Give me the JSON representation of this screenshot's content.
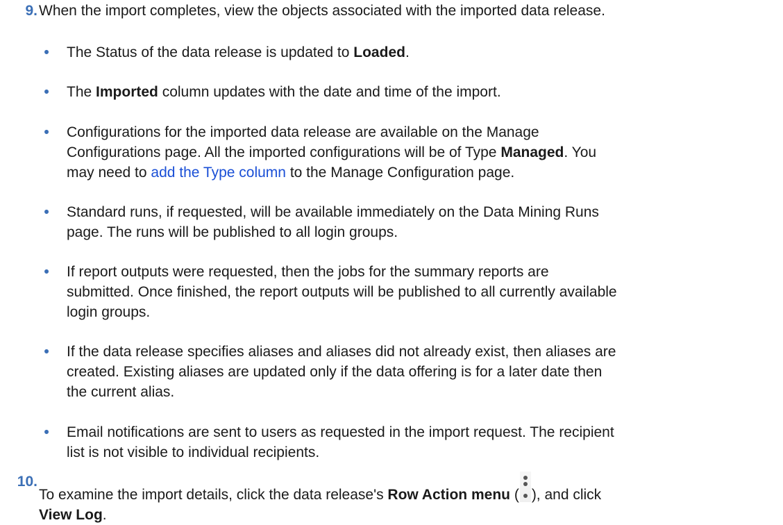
{
  "step9": {
    "number": "9.",
    "text": "When the import completes, view the objects associated with the imported data release."
  },
  "bullets": [
    {
      "parts": [
        {
          "t": "The Status of the data release is updated to "
        },
        {
          "t": "Loaded",
          "b": true
        },
        {
          "t": "."
        }
      ]
    },
    {
      "parts": [
        {
          "t": "The "
        },
        {
          "t": "Imported",
          "b": true
        },
        {
          "t": " column updates with the date and time of the import."
        }
      ]
    },
    {
      "lines": [
        [
          {
            "t": "Configurations for the imported data release are available on the Manage"
          }
        ],
        [
          {
            "t": "Configurations page. All the imported configurations will be of Type "
          },
          {
            "t": "Managed",
            "b": true
          },
          {
            "t": ". You"
          }
        ],
        [
          {
            "t": "may need to "
          },
          {
            "t": "add the Type column",
            "link": true
          },
          {
            "t": " to the Manage Configuration page."
          }
        ]
      ]
    },
    {
      "lines": [
        [
          {
            "t": "Standard runs, if requested, will be available immediately on the Data Mining Runs"
          }
        ],
        [
          {
            "t": "page. The runs will be published to all login groups."
          }
        ]
      ]
    },
    {
      "lines": [
        [
          {
            "t": "If report outputs were requested, then the jobs for the summary reports are"
          }
        ],
        [
          {
            "t": "submitted. Once finished, the report outputs will be published to all currently available"
          }
        ],
        [
          {
            "t": "login groups."
          }
        ]
      ]
    },
    {
      "lines": [
        [
          {
            "t": "If the data release specifies aliases and aliases did not already exist, then aliases are"
          }
        ],
        [
          {
            "t": "created. Existing aliases are updated only if the data offering is for a later date then"
          }
        ],
        [
          {
            "t": "the current alias."
          }
        ]
      ]
    },
    {
      "lines": [
        [
          {
            "t": "Email notifications are sent to users as requested in the import request. The recipient"
          }
        ],
        [
          {
            "t": "list is not visible to individual recipients."
          }
        ]
      ]
    }
  ],
  "bullet_glyph": "•",
  "step10": {
    "number": "10.",
    "line1_before": "To examine the import details, click the data release's ",
    "line1_bold": "Row Action menu",
    "line1_paren_open": " (",
    "icon": "kebab-menu-icon",
    "line1_after": "), and click",
    "line2_bold": "View Log",
    "line2_after": "."
  }
}
